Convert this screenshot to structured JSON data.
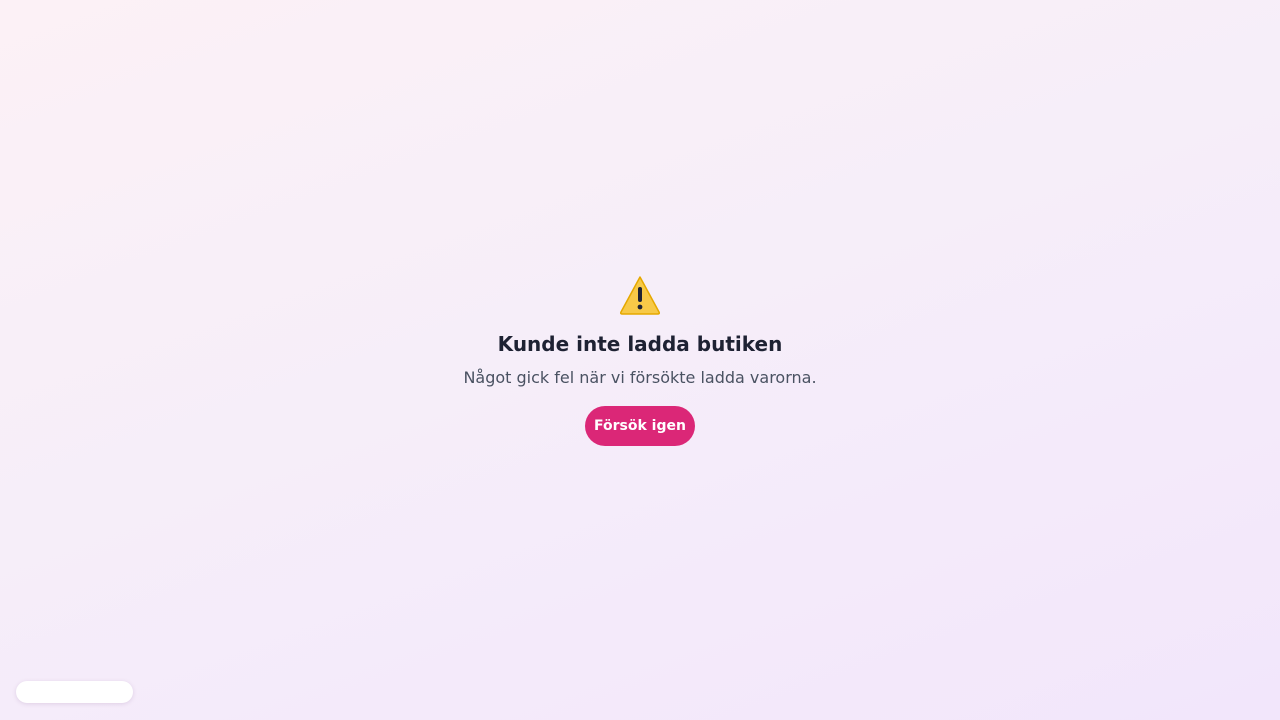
{
  "error": {
    "icon": "warning-icon",
    "title": "Kunde inte ladda butiken",
    "message": "Något gick fel när vi försökte ladda varorna.",
    "retry_label": "Försök igen"
  },
  "colors": {
    "accent": "#db2777",
    "title_text": "#1e2233",
    "body_text": "#4a5262",
    "warning_fill": "#f7c948"
  }
}
